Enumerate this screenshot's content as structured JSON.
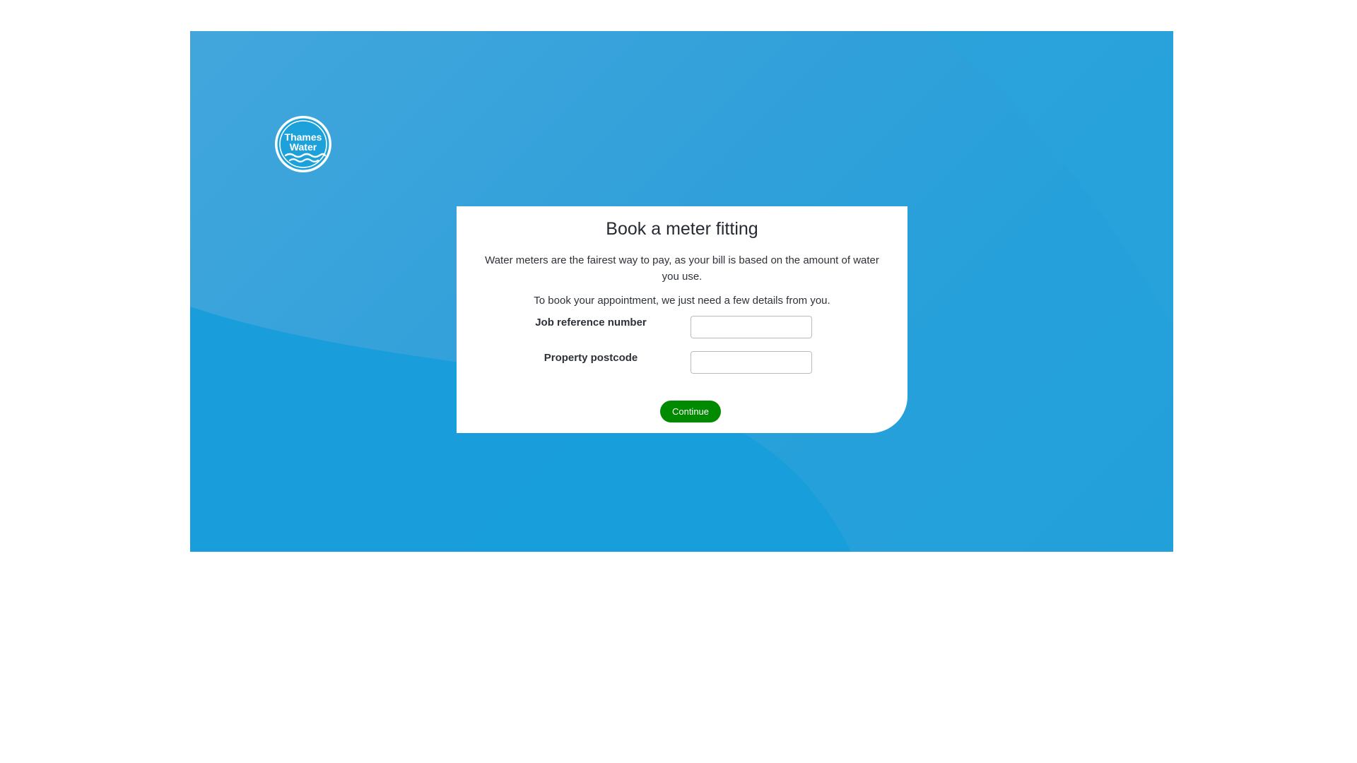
{
  "brand": {
    "logo_line1": "Thames",
    "logo_line2": "Water"
  },
  "card": {
    "title": "Book a meter fitting",
    "intro": "Water meters are the fairest way to pay, as your bill is based on the amount of water you use.",
    "instructions": "To book your appointment, we just need a few details from you."
  },
  "form": {
    "job_reference_label": "Job reference number",
    "job_reference_value": "",
    "postcode_label": "Property postcode",
    "postcode_value": "",
    "continue_label": "Continue"
  },
  "colors": {
    "brand_blue": "#22a0da",
    "button_green": "#008a00",
    "text_dark": "#2d3138"
  }
}
